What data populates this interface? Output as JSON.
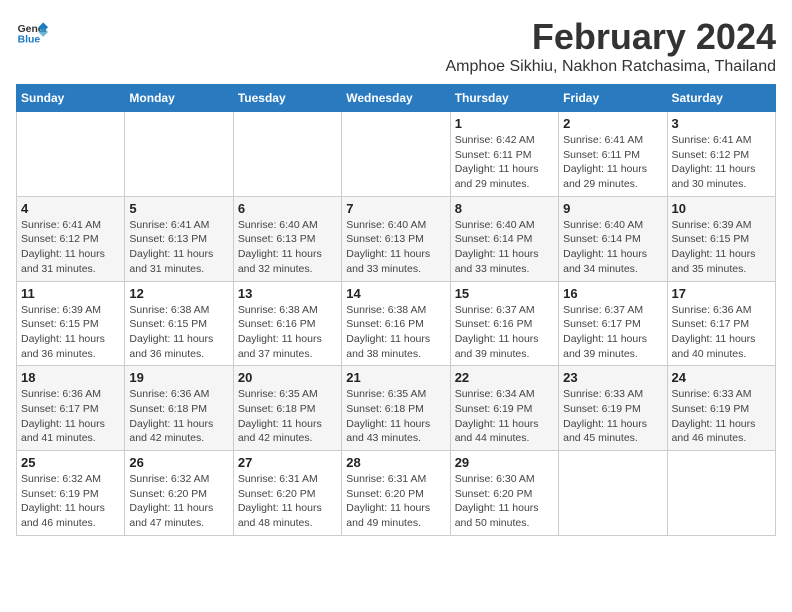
{
  "header": {
    "logo_general": "General",
    "logo_blue": "Blue",
    "title": "February 2024",
    "subtitle": "Amphoe Sikhiu, Nakhon Ratchasima, Thailand"
  },
  "days": [
    "Sunday",
    "Monday",
    "Tuesday",
    "Wednesday",
    "Thursday",
    "Friday",
    "Saturday"
  ],
  "weeks": [
    [
      {
        "day": "",
        "info": ""
      },
      {
        "day": "",
        "info": ""
      },
      {
        "day": "",
        "info": ""
      },
      {
        "day": "",
        "info": ""
      },
      {
        "day": "1",
        "info": "Sunrise: 6:42 AM\nSunset: 6:11 PM\nDaylight: 11 hours\nand 29 minutes."
      },
      {
        "day": "2",
        "info": "Sunrise: 6:41 AM\nSunset: 6:11 PM\nDaylight: 11 hours\nand 29 minutes."
      },
      {
        "day": "3",
        "info": "Sunrise: 6:41 AM\nSunset: 6:12 PM\nDaylight: 11 hours\nand 30 minutes."
      }
    ],
    [
      {
        "day": "4",
        "info": "Sunrise: 6:41 AM\nSunset: 6:12 PM\nDaylight: 11 hours\nand 31 minutes."
      },
      {
        "day": "5",
        "info": "Sunrise: 6:41 AM\nSunset: 6:13 PM\nDaylight: 11 hours\nand 31 minutes."
      },
      {
        "day": "6",
        "info": "Sunrise: 6:40 AM\nSunset: 6:13 PM\nDaylight: 11 hours\nand 32 minutes."
      },
      {
        "day": "7",
        "info": "Sunrise: 6:40 AM\nSunset: 6:13 PM\nDaylight: 11 hours\nand 33 minutes."
      },
      {
        "day": "8",
        "info": "Sunrise: 6:40 AM\nSunset: 6:14 PM\nDaylight: 11 hours\nand 33 minutes."
      },
      {
        "day": "9",
        "info": "Sunrise: 6:40 AM\nSunset: 6:14 PM\nDaylight: 11 hours\nand 34 minutes."
      },
      {
        "day": "10",
        "info": "Sunrise: 6:39 AM\nSunset: 6:15 PM\nDaylight: 11 hours\nand 35 minutes."
      }
    ],
    [
      {
        "day": "11",
        "info": "Sunrise: 6:39 AM\nSunset: 6:15 PM\nDaylight: 11 hours\nand 36 minutes."
      },
      {
        "day": "12",
        "info": "Sunrise: 6:38 AM\nSunset: 6:15 PM\nDaylight: 11 hours\nand 36 minutes."
      },
      {
        "day": "13",
        "info": "Sunrise: 6:38 AM\nSunset: 6:16 PM\nDaylight: 11 hours\nand 37 minutes."
      },
      {
        "day": "14",
        "info": "Sunrise: 6:38 AM\nSunset: 6:16 PM\nDaylight: 11 hours\nand 38 minutes."
      },
      {
        "day": "15",
        "info": "Sunrise: 6:37 AM\nSunset: 6:16 PM\nDaylight: 11 hours\nand 39 minutes."
      },
      {
        "day": "16",
        "info": "Sunrise: 6:37 AM\nSunset: 6:17 PM\nDaylight: 11 hours\nand 39 minutes."
      },
      {
        "day": "17",
        "info": "Sunrise: 6:36 AM\nSunset: 6:17 PM\nDaylight: 11 hours\nand 40 minutes."
      }
    ],
    [
      {
        "day": "18",
        "info": "Sunrise: 6:36 AM\nSunset: 6:17 PM\nDaylight: 11 hours\nand 41 minutes."
      },
      {
        "day": "19",
        "info": "Sunrise: 6:36 AM\nSunset: 6:18 PM\nDaylight: 11 hours\nand 42 minutes."
      },
      {
        "day": "20",
        "info": "Sunrise: 6:35 AM\nSunset: 6:18 PM\nDaylight: 11 hours\nand 42 minutes."
      },
      {
        "day": "21",
        "info": "Sunrise: 6:35 AM\nSunset: 6:18 PM\nDaylight: 11 hours\nand 43 minutes."
      },
      {
        "day": "22",
        "info": "Sunrise: 6:34 AM\nSunset: 6:19 PM\nDaylight: 11 hours\nand 44 minutes."
      },
      {
        "day": "23",
        "info": "Sunrise: 6:33 AM\nSunset: 6:19 PM\nDaylight: 11 hours\nand 45 minutes."
      },
      {
        "day": "24",
        "info": "Sunrise: 6:33 AM\nSunset: 6:19 PM\nDaylight: 11 hours\nand 46 minutes."
      }
    ],
    [
      {
        "day": "25",
        "info": "Sunrise: 6:32 AM\nSunset: 6:19 PM\nDaylight: 11 hours\nand 46 minutes."
      },
      {
        "day": "26",
        "info": "Sunrise: 6:32 AM\nSunset: 6:20 PM\nDaylight: 11 hours\nand 47 minutes."
      },
      {
        "day": "27",
        "info": "Sunrise: 6:31 AM\nSunset: 6:20 PM\nDaylight: 11 hours\nand 48 minutes."
      },
      {
        "day": "28",
        "info": "Sunrise: 6:31 AM\nSunset: 6:20 PM\nDaylight: 11 hours\nand 49 minutes."
      },
      {
        "day": "29",
        "info": "Sunrise: 6:30 AM\nSunset: 6:20 PM\nDaylight: 11 hours\nand 50 minutes."
      },
      {
        "day": "",
        "info": ""
      },
      {
        "day": "",
        "info": ""
      }
    ]
  ]
}
